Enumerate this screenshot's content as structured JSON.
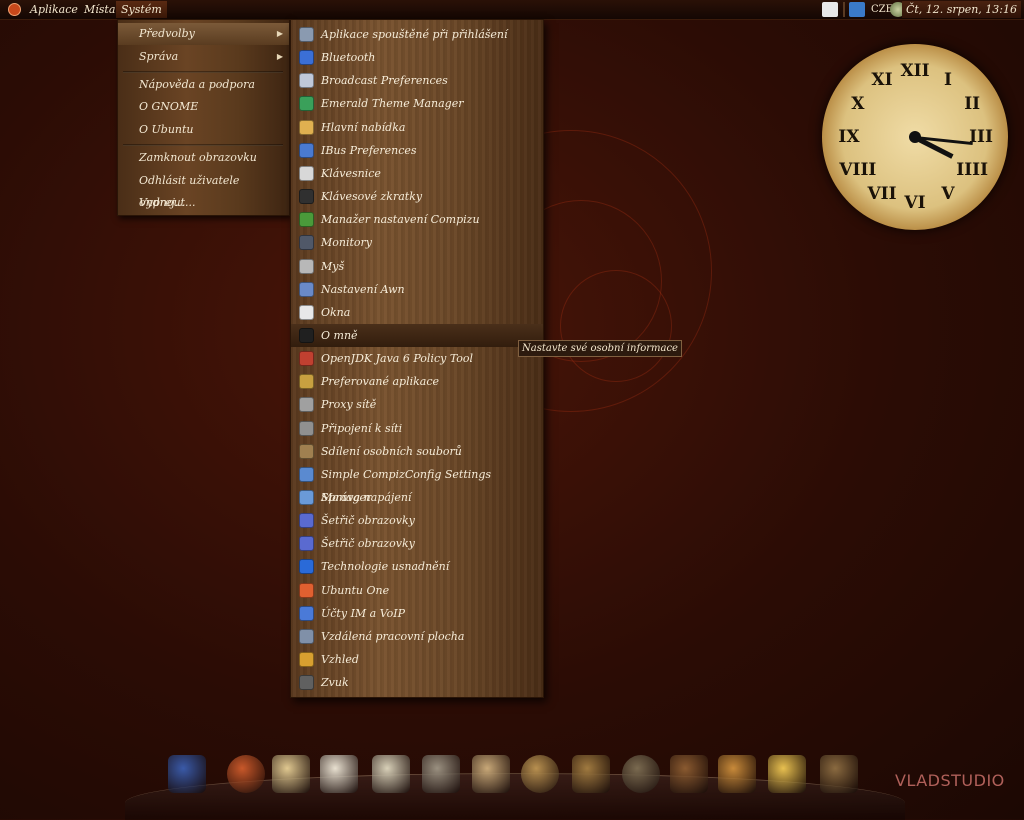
{
  "top_panel": {
    "menus": [
      "Aplikace",
      "Místa",
      "Systém"
    ],
    "keyboard_layout": "CZE",
    "datetime": "Čt, 12. srpen, 13:16"
  },
  "system_menu": {
    "items": [
      "Předvolby",
      "Správa",
      "Nápověda a podpora",
      "O GNOME",
      "O Ubuntu",
      "Zamknout obrazovku",
      "Odhlásit uživatele ondrej...",
      "Vypnout..."
    ]
  },
  "preferences_menu": {
    "items": [
      {
        "label": "Aplikace spouštěné při přihlášení",
        "icon": "startup-apps-icon",
        "color": "#8a9ab0"
      },
      {
        "label": "Bluetooth",
        "icon": "bluetooth-icon",
        "color": "#3b6fd6"
      },
      {
        "label": "Broadcast Preferences",
        "icon": "broadcast-icon",
        "color": "#c0c8d8"
      },
      {
        "label": "Emerald Theme Manager",
        "icon": "emerald-icon",
        "color": "#3aa05a"
      },
      {
        "label": "Hlavní nabídka",
        "icon": "main-menu-icon",
        "color": "#e0b050"
      },
      {
        "label": "IBus Preferences",
        "icon": "ibus-icon",
        "color": "#4a7ad0"
      },
      {
        "label": "Klávesnice",
        "icon": "keyboard-icon",
        "color": "#d8d8d8"
      },
      {
        "label": "Klávesové zkratky",
        "icon": "shortcuts-icon",
        "color": "#303030"
      },
      {
        "label": "Manažer nastavení Compizu",
        "icon": "compiz-icon",
        "color": "#4a9a3a"
      },
      {
        "label": "Monitory",
        "icon": "monitor-icon",
        "color": "#505868"
      },
      {
        "label": "Myš",
        "icon": "mouse-icon",
        "color": "#b8b8b8"
      },
      {
        "label": "Nastavení Awn",
        "icon": "awn-icon",
        "color": "#6a8ac8"
      },
      {
        "label": "Okna",
        "icon": "windows-icon",
        "color": "#e8e8e8"
      },
      {
        "label": "O mně",
        "icon": "about-me-icon",
        "color": "#202020"
      },
      {
        "label": "OpenJDK Java 6 Policy Tool",
        "icon": "java-icon",
        "color": "#c04030"
      },
      {
        "label": "Preferované aplikace",
        "icon": "preferred-apps-icon",
        "color": "#c8a040"
      },
      {
        "label": "Proxy sítě",
        "icon": "proxy-icon",
        "color": "#a0a0a0"
      },
      {
        "label": "Připojení k síti",
        "icon": "network-icon",
        "color": "#909090"
      },
      {
        "label": "Sdílení osobních souborů",
        "icon": "file-sharing-icon",
        "color": "#a08050"
      },
      {
        "label": "Simple CompizConfig Settings Manager",
        "icon": "ccsm-icon",
        "color": "#5a8ad0"
      },
      {
        "label": "Správa napájení",
        "icon": "power-icon",
        "color": "#6a9ad8"
      },
      {
        "label": "Šetřič obrazovky",
        "icon": "screensaver-icon",
        "color": "#5a6ad0"
      },
      {
        "label": "Šetřič obrazovky",
        "icon": "screensaver-icon",
        "color": "#5a6ad0"
      },
      {
        "label": "Technologie usnadnění",
        "icon": "accessibility-icon",
        "color": "#2a6ad8"
      },
      {
        "label": "Ubuntu One",
        "icon": "ubuntu-one-icon",
        "color": "#e06030"
      },
      {
        "label": "Účty IM a VoIP",
        "icon": "im-accounts-icon",
        "color": "#4a7ad8"
      },
      {
        "label": "Vzdálená pracovní plocha",
        "icon": "remote-desktop-icon",
        "color": "#8090a8"
      },
      {
        "label": "Vzhled",
        "icon": "appearance-icon",
        "color": "#d8a030"
      },
      {
        "label": "Zvuk",
        "icon": "sound-icon",
        "color": "#606060"
      }
    ],
    "hovered": "O mně"
  },
  "tooltip": "Nastavte své osobní informace",
  "clock": {
    "numerals": [
      "XII",
      "I",
      "II",
      "III",
      "IIII",
      "V",
      "VI",
      "VII",
      "VIII",
      "IX",
      "X",
      "XI"
    ]
  },
  "dock": {
    "icons": [
      "awn-switcher-icon",
      "firefox-icon",
      "mail-icon",
      "chat-icon",
      "text-editor-icon",
      "file-manager-icon",
      "telescope-icon",
      "clock-icon",
      "lamp-icon",
      "globe-icon",
      "books-icon",
      "folder-icon",
      "weather-icon",
      "trash-icon"
    ],
    "brand": "VLADSTUDIO"
  }
}
